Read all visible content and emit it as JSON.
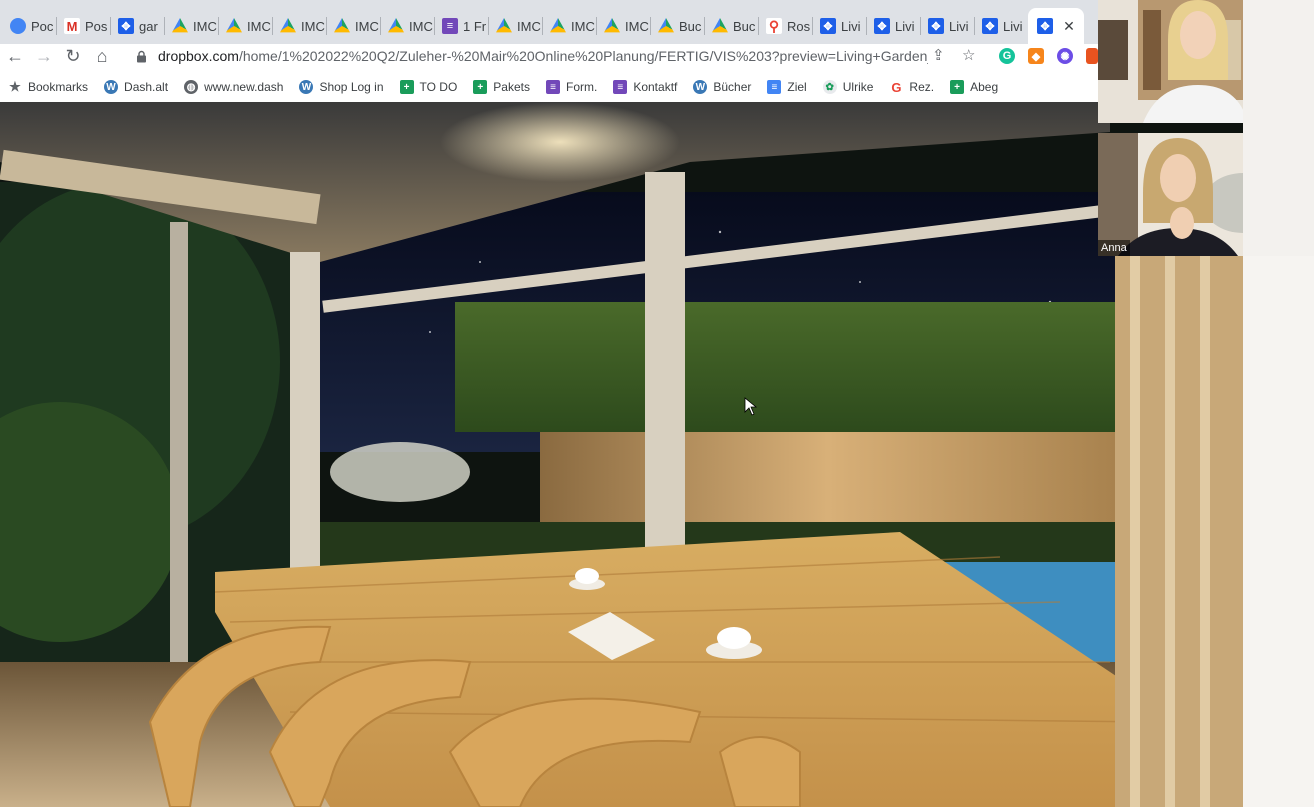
{
  "browser": {
    "tabs": [
      {
        "label": "Poc",
        "icon": "circle-app-icon",
        "favclass": "f-circle",
        "glyph": ""
      },
      {
        "label": "Pos",
        "icon": "gmail-icon",
        "favclass": "f-gmail",
        "glyph": "M"
      },
      {
        "label": "gar",
        "icon": "dropbox-icon",
        "favclass": "f-blue",
        "glyph": "✥"
      },
      {
        "label": "IMC",
        "icon": "google-drive-icon",
        "favclass": "f-drive",
        "glyph": ""
      },
      {
        "label": "IMC",
        "icon": "google-drive-icon",
        "favclass": "f-drive",
        "glyph": ""
      },
      {
        "label": "IMC",
        "icon": "google-drive-icon",
        "favclass": "f-drive",
        "glyph": ""
      },
      {
        "label": "IMC",
        "icon": "google-drive-icon",
        "favclass": "f-drive",
        "glyph": ""
      },
      {
        "label": "IMC",
        "icon": "google-drive-icon",
        "favclass": "f-drive",
        "glyph": ""
      },
      {
        "label": "1 Fr",
        "icon": "forms-icon",
        "favclass": "f-purple",
        "glyph": "≡"
      },
      {
        "label": "IMC",
        "icon": "google-drive-icon",
        "favclass": "f-drive",
        "glyph": ""
      },
      {
        "label": "IMC",
        "icon": "google-drive-icon",
        "favclass": "f-drive",
        "glyph": ""
      },
      {
        "label": "IMC",
        "icon": "google-drive-icon",
        "favclass": "f-drive",
        "glyph": ""
      },
      {
        "label": "Buc",
        "icon": "google-drive-icon",
        "favclass": "f-drive",
        "glyph": ""
      },
      {
        "label": "Buc",
        "icon": "google-drive-icon",
        "favclass": "f-drive",
        "glyph": ""
      },
      {
        "label": "Ros",
        "icon": "google-maps-icon",
        "favclass": "f-maps",
        "glyph": "⚲"
      },
      {
        "label": "Livi",
        "icon": "dropbox-icon",
        "favclass": "f-blue",
        "glyph": "✥"
      },
      {
        "label": "Livi",
        "icon": "dropbox-icon",
        "favclass": "f-blue",
        "glyph": "✥"
      },
      {
        "label": "Livi",
        "icon": "dropbox-icon",
        "favclass": "f-blue",
        "glyph": "✥"
      },
      {
        "label": "Livi",
        "icon": "dropbox-icon",
        "favclass": "f-blue",
        "glyph": "✥"
      }
    ],
    "active_tab": {
      "icon": "dropbox-icon",
      "close_glyph": "✕"
    },
    "nav": {
      "back": "←",
      "forward": "→",
      "reload": "↻",
      "home": "⌂"
    },
    "address": {
      "host": "dropbox.com",
      "path": "/home/1%202022%20Q2/Zuleher-%20Mair%20Online%20Planung/FERTIG/VIS%203?preview=Living+Garden_..."
    },
    "omni_icons": {
      "share": "⇪",
      "star": "☆"
    },
    "bookmarks": [
      {
        "label": "Bookmarks",
        "icon": "star-icon",
        "cls": "",
        "glyph": "★"
      },
      {
        "label": "Dash.alt",
        "icon": "wordpress-icon",
        "cls": "bm-wp",
        "glyph": "W"
      },
      {
        "label": "www.new.dash",
        "icon": "globe-icon",
        "cls": "bm-globe",
        "glyph": "◍"
      },
      {
        "label": "Shop Log in",
        "icon": "wordpress-icon",
        "cls": "bm-wp",
        "glyph": "W"
      },
      {
        "label": "TO DO",
        "icon": "sheets-icon",
        "cls": "bm-green",
        "glyph": "+"
      },
      {
        "label": "Pakets",
        "icon": "sheets-icon",
        "cls": "bm-green",
        "glyph": "+"
      },
      {
        "label": "Form.",
        "icon": "forms-icon",
        "cls": "bm-purple",
        "glyph": "≡"
      },
      {
        "label": "Kontaktf",
        "icon": "forms-icon",
        "cls": "bm-purple",
        "glyph": "≡"
      },
      {
        "label": "Bücher",
        "icon": "wordpress-icon",
        "cls": "bm-wp",
        "glyph": "W"
      },
      {
        "label": "Ziel",
        "icon": "docs-icon",
        "cls": "bm-doc",
        "glyph": "≡"
      },
      {
        "label": "Ulrike",
        "icon": "app-icon",
        "cls": "bm-ul",
        "glyph": "✿"
      },
      {
        "label": "Rez.",
        "icon": "google-icon",
        "cls": "bm-g",
        "glyph": "G"
      },
      {
        "label": "Abeg",
        "icon": "sheets-icon",
        "cls": "bm-green",
        "glyph": "+"
      }
    ]
  },
  "participants": [
    {
      "name": ""
    },
    {
      "name": "Anna"
    }
  ]
}
